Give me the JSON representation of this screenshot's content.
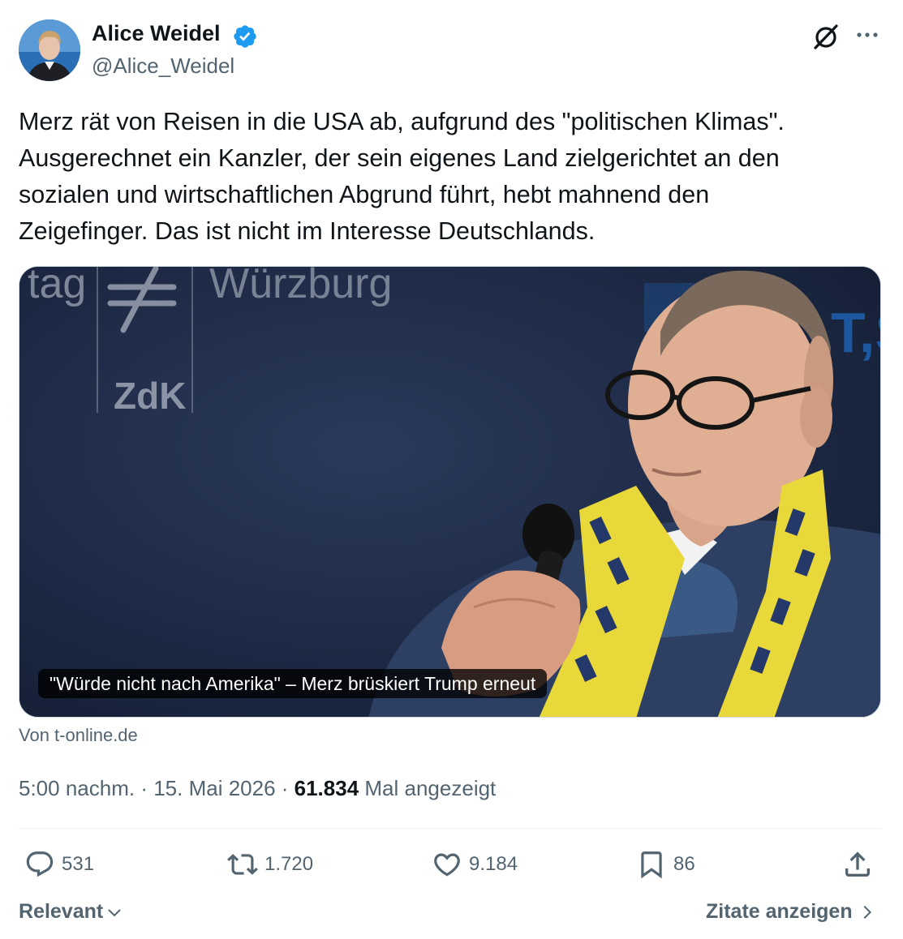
{
  "author": {
    "name": "Alice Weidel",
    "handle": "@Alice_Weidel",
    "avatar_icon": "avatar",
    "verified_color": "#1d9bf0"
  },
  "header_icons": [
    "grok-icon",
    "more-icon"
  ],
  "tweet": {
    "lines": [
      "Merz rät von Reisen in die USA ab, aufgrund des \"politischen Klimas\".",
      "Ausgerechnet ein Kanzler, der sein eigenes Land zielgerichtet an den",
      "sozialen und wirtschaftlichen Abgrund führt, hebt mahnend den",
      "Zeigefinger. Das ist nicht im Interesse Deutschlands."
    ]
  },
  "card": {
    "caption": "\"Würde nicht nach Amerika\" – Merz brüskiert Trump erneut",
    "source": "Von t-online.de",
    "background_text": {
      "tag": "tag",
      "city": "Würzburg",
      "logo": "ZdK",
      "right": "T,S"
    }
  },
  "meta": {
    "time": "5:00 nachm.",
    "sep1": " · ",
    "date": "15. Mai 2026",
    "sep2": " · ",
    "views": "61.834",
    "views_label": " Mal angezeigt"
  },
  "actions": {
    "replies": "531",
    "retweets": "1.720",
    "likes": "9.184",
    "bookmarks": "86"
  },
  "footer": {
    "sort_label": "Relevant",
    "quotes_label": "Zitate anzeigen"
  },
  "colors": {
    "text": "#0f1419",
    "secondary": "#536471",
    "accent": "#1d9bf0"
  }
}
